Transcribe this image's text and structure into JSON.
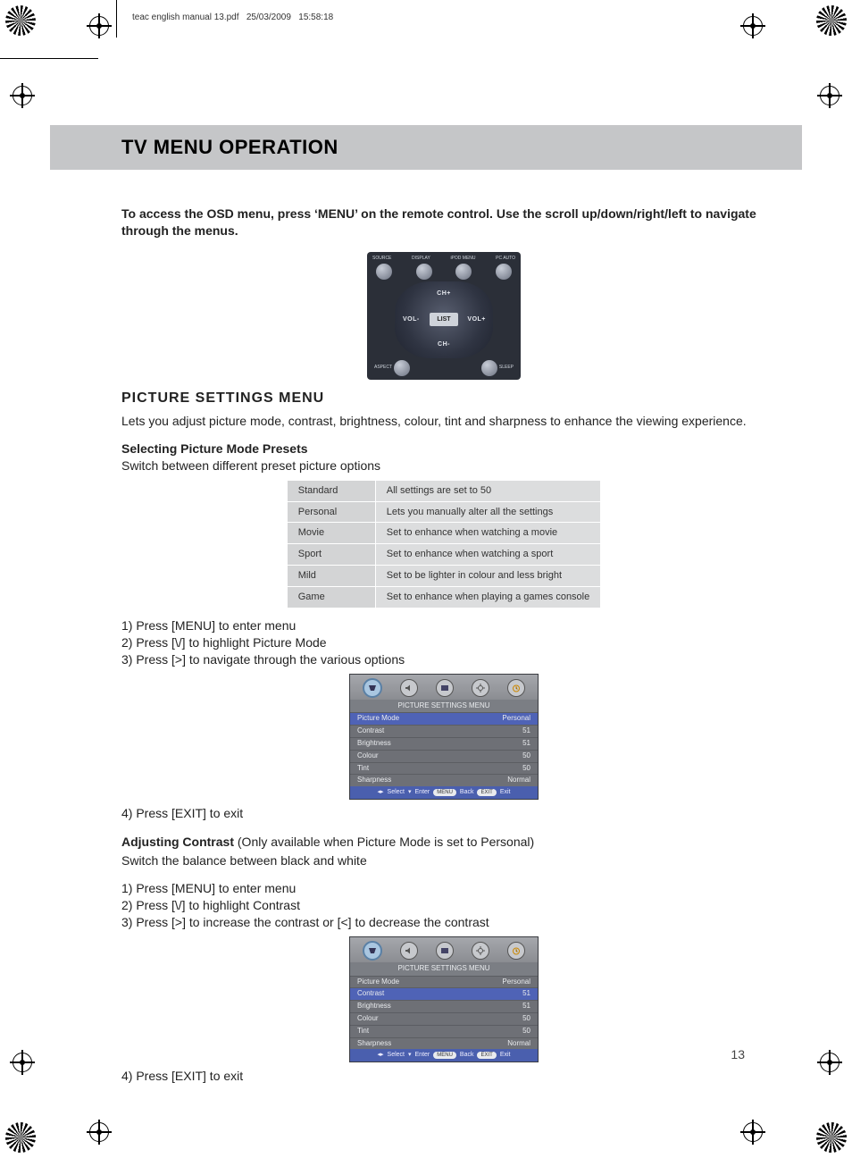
{
  "meta": {
    "filename": "teac english manual 13.pdf",
    "date": "25/03/2009",
    "time": "15:58:18"
  },
  "title": "TV MENU OPERATION",
  "intro": "To access the OSD menu, press ‘MENU’ on the remote control. Use the scroll up/down/right/left to navigate through the menus.",
  "remote": {
    "top_labels": [
      "SOURCE",
      "DISPLAY",
      "iPOD MENU",
      "PC AUTO"
    ],
    "up": "CH+",
    "down": "CH-",
    "left": "VOL-",
    "right": "VOL+",
    "center": "LIST",
    "bottom_left": "ASPECT",
    "bottom_right": "SLEEP"
  },
  "section_heading": "PICTURE SETTINGS MENU",
  "section_lead": "Lets you adjust picture mode, contrast, brightness, colour, tint and sharpness to enhance the viewing experience.",
  "presets_heading": "Selecting Picture Mode Presets",
  "presets_sub": "Switch between different preset picture options",
  "preset_rows": [
    {
      "name": "Standard",
      "desc": "All settings are set to 50"
    },
    {
      "name": "Personal",
      "desc": "Lets you manually alter all the settings"
    },
    {
      "name": "Movie",
      "desc": "Set to enhance when watching a movie"
    },
    {
      "name": "Sport",
      "desc": "Set to enhance when watching a sport"
    },
    {
      "name": "Mild",
      "desc": "Set to be lighter in colour and less bright"
    },
    {
      "name": "Game",
      "desc": "Set to enhance when playing a games console"
    }
  ],
  "steps_a": [
    "1) Press [MENU] to enter menu",
    "2) Press [\\/] to highlight Picture Mode",
    "3) Press [>] to navigate through the various options"
  ],
  "step_exit": "4) Press [EXIT] to exit",
  "osd": {
    "title": "PICTURE SETTINGS MENU",
    "rows": [
      {
        "label": "Picture Mode",
        "value": "Personal"
      },
      {
        "label": "Contrast",
        "value": "51"
      },
      {
        "label": "Brightness",
        "value": "51"
      },
      {
        "label": "Colour",
        "value": "50"
      },
      {
        "label": "Tint",
        "value": "50"
      },
      {
        "label": "Sharpness",
        "value": "Normal"
      }
    ],
    "foot_select": "Select",
    "foot_enter": "Enter",
    "foot_menu": "MENU",
    "foot_back": "Back",
    "foot_exitpill": "EXIT",
    "foot_exit": "Exit"
  },
  "contrast_heading": "Adjusting Contrast",
  "contrast_note": "(Only available when Picture Mode is set to Personal)",
  "contrast_sub": "Switch the balance between black and white",
  "steps_b": [
    "1) Press [MENU] to enter menu",
    "2) Press [\\/] to highlight Contrast",
    "3) Press [>] to increase the contrast or [<] to decrease the contrast"
  ],
  "page_number": "13"
}
